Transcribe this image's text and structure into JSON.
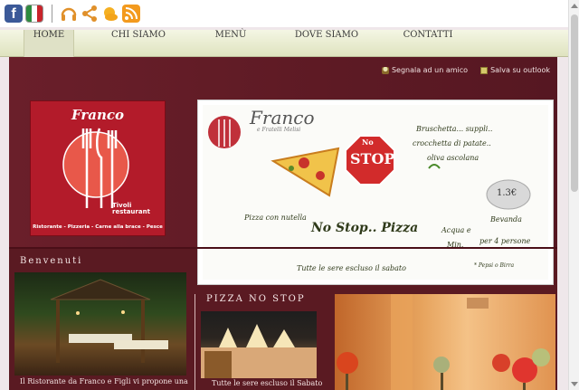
{
  "social": {
    "icons": [
      "facebook-icon",
      "italy-flag-icon",
      "headphones-icon",
      "share-icon",
      "weather-icon",
      "rss-icon"
    ],
    "fb_glyph": "f"
  },
  "nav": {
    "items": [
      {
        "label": "HOME",
        "active": true
      },
      {
        "label": "CHI SIAMO",
        "active": false
      },
      {
        "label": "MENÙ",
        "active": false
      },
      {
        "label": "DOVE SIAMO",
        "active": false
      },
      {
        "label": "CONTATTI",
        "active": false
      }
    ]
  },
  "actions": {
    "recommend": "Segnala ad un amico",
    "outlook": "Salva su outlook"
  },
  "logo": {
    "brand": "Franco",
    "location": "Tivoli\nrestaurant",
    "tagline": "Ristorante - Pizzeria - Carne alla brace - Pesce"
  },
  "promo": {
    "brand": "Franco",
    "brand_sub": "e Fratelli Melisi",
    "sign_small": "No",
    "sign_big": "STOP",
    "menu_line1": "Bruschetta... suppli..",
    "menu_line2": "crocchetta di patate..",
    "menu_line3": "oliva ascolana",
    "price": "1.3€",
    "nutella": "Pizza con nutella",
    "no_stop": "No Stop.. Pizza",
    "bevanda": "Bevanda",
    "acqua": "Acqua e",
    "min": "Min.",
    "persone": "per 4 persone",
    "sabato": "Tutte le sere escluso il sabato",
    "note": "* Pepsi o Birra"
  },
  "sections": {
    "benvenuti": {
      "title": "Benvenuti",
      "caption": "Il Ristorante da Franco e Figli vi propone una"
    },
    "pizza": {
      "title": "PIZZA NO STOP",
      "caption": "Tutte le sere escluso il Sabato"
    }
  },
  "colors": {
    "maroon": "#5a1a22",
    "logo_red": "#b31b2a",
    "nav_bg": "#e6e9ca"
  }
}
